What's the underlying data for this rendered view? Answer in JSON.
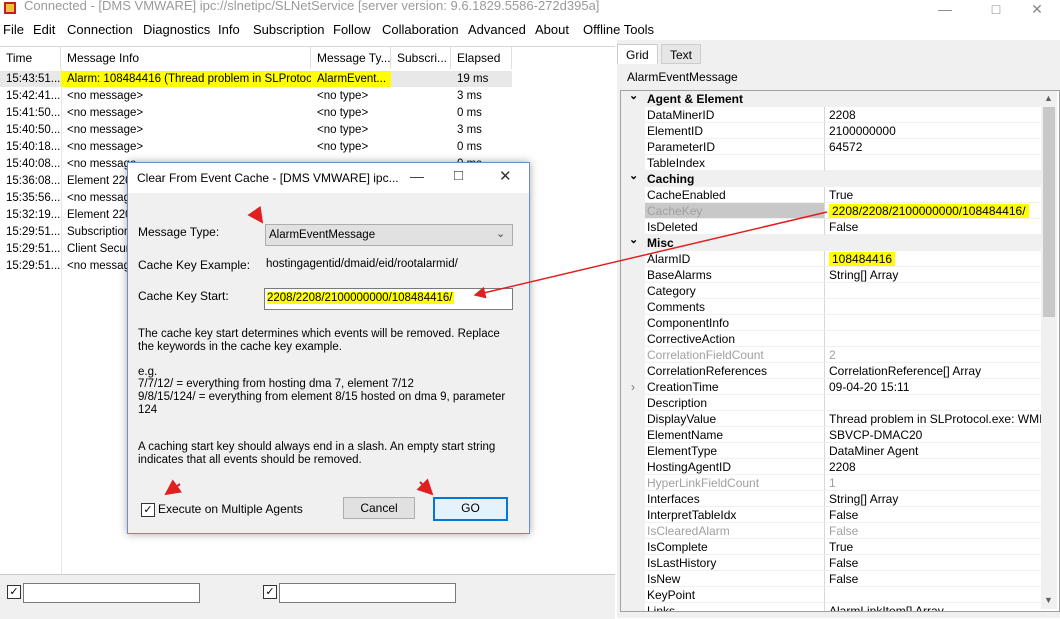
{
  "window": {
    "title": "Connected - [DMS VMWARE] ipc://slnetipc/SLNetService [server version: 9.6.1829.5586-272d395a]"
  },
  "menu": [
    "File",
    "Edit",
    "Connection",
    "Diagnostics",
    "Info",
    "Subscription",
    "Follow",
    "Collaboration",
    "Advanced",
    "About",
    "Offline Tools"
  ],
  "list": {
    "columns": [
      "Time",
      "Message Info",
      "Message Ty...",
      "Subscri...",
      "Elapsed"
    ],
    "rows": [
      {
        "time": "15:43:51...",
        "info": "Alarm: 108484416 (Thread problem in SLProtoc...",
        "type": "AlarmEvent...",
        "sub": "",
        "elapsed": "19 ms"
      },
      {
        "time": "15:42:41...",
        "info": "<no message>",
        "type": "<no type>",
        "sub": "",
        "elapsed": "3 ms"
      },
      {
        "time": "15:41:50...",
        "info": "<no message>",
        "type": "<no type>",
        "sub": "",
        "elapsed": "0 ms"
      },
      {
        "time": "15:40:50...",
        "info": "<no message>",
        "type": "<no type>",
        "sub": "",
        "elapsed": "3 ms"
      },
      {
        "time": "15:40:18...",
        "info": "<no message>",
        "type": "<no type>",
        "sub": "",
        "elapsed": "0 ms"
      },
      {
        "time": "15:40:08...",
        "info": "<no message",
        "type": "",
        "sub": "",
        "elapsed": "0 ms"
      },
      {
        "time": "15:36:08...",
        "info": "Element 2208",
        "type": "",
        "sub": "",
        "elapsed": ""
      },
      {
        "time": "15:35:56...",
        "info": "<no message",
        "type": "",
        "sub": "",
        "elapsed": ""
      },
      {
        "time": "15:32:19...",
        "info": "Element 2208",
        "type": "",
        "sub": "",
        "elapsed": ""
      },
      {
        "time": "15:29:51...",
        "info": "Subscription",
        "type": "",
        "sub": "",
        "elapsed": ""
      },
      {
        "time": "15:29:51...",
        "info": "Client Securit",
        "type": "",
        "sub": "",
        "elapsed": ""
      },
      {
        "time": "15:29:51...",
        "info": "<no message",
        "type": "",
        "sub": "",
        "elapsed": ""
      }
    ]
  },
  "right": {
    "tabs": [
      "Grid",
      "Text"
    ],
    "object_title": "AlarmEventMessage",
    "properties": [
      {
        "cat": "Agent & Element"
      },
      {
        "n": "DataMinerID",
        "v": "2208"
      },
      {
        "n": "ElementID",
        "v": "2100000000"
      },
      {
        "n": "ParameterID",
        "v": "64572"
      },
      {
        "n": "TableIndex",
        "v": ""
      },
      {
        "cat": "Caching"
      },
      {
        "n": "CacheEnabled",
        "v": "True"
      },
      {
        "n": "CacheKey",
        "v": "2208/2208/2100000000/108484416/",
        "gray": true,
        "hl": true
      },
      {
        "n": "IsDeleted",
        "v": "False"
      },
      {
        "cat": "Misc"
      },
      {
        "n": "AlarmID",
        "v": "108484416",
        "hl": true
      },
      {
        "n": "BaseAlarms",
        "v": "String[] Array"
      },
      {
        "n": "Category",
        "v": ""
      },
      {
        "n": "Comments",
        "v": ""
      },
      {
        "n": "ComponentInfo",
        "v": ""
      },
      {
        "n": "CorrectiveAction",
        "v": ""
      },
      {
        "n": "CorrelationFieldCount",
        "v": "2",
        "gray": true
      },
      {
        "n": "CorrelationReferences",
        "v": "CorrelationReference[] Array"
      },
      {
        "n": "CreationTime",
        "v": "09-04-20 15:11",
        "expand": true
      },
      {
        "n": "Description",
        "v": ""
      },
      {
        "n": "DisplayValue",
        "v": "Thread problem in SLProtocol.exe: WMIQuer"
      },
      {
        "n": "ElementName",
        "v": "SBVCP-DMAC20"
      },
      {
        "n": "ElementType",
        "v": "DataMiner Agent"
      },
      {
        "n": "HostingAgentID",
        "v": "2208"
      },
      {
        "n": "HyperLinkFieldCount",
        "v": "1",
        "gray": true
      },
      {
        "n": "Interfaces",
        "v": "String[] Array"
      },
      {
        "n": "InterpretTableIdx",
        "v": "False"
      },
      {
        "n": "IsClearedAlarm",
        "v": "False",
        "gray": true
      },
      {
        "n": "IsComplete",
        "v": "True"
      },
      {
        "n": "IsLastHistory",
        "v": "False"
      },
      {
        "n": "IsNew",
        "v": "False"
      },
      {
        "n": "KeyPoint",
        "v": ""
      },
      {
        "n": "Links",
        "v": "AlarmLinkItem[] Array"
      }
    ]
  },
  "dialog": {
    "title": "Clear From Event Cache - [DMS VMWARE] ipc...",
    "message_type_label": "Message Type:",
    "message_type_value": "AlarmEventMessage",
    "example_label": "Cache Key Example:",
    "example_value": "hostingagentid/dmaid/eid/rootalarmid/",
    "start_label": "Cache Key Start:",
    "start_value": "2208/2208/2100000000/108484416/",
    "help1": "The cache key start determines which events will be removed. Replace the keywords in the cache key example.",
    "eg": "e.g.",
    "eg1": "7/7/12/ = everything from hosting dma 7, element 7/12",
    "eg2": "9/8/15/124/ = everything from element 8/15 hosted on dma 9, parameter 124",
    "help2": "A caching start key should always end in a slash. An empty start string indicates that all events should be removed.",
    "multi_label": "Execute on Multiple Agents",
    "multi_checked": true,
    "cancel": "Cancel",
    "go": "GO"
  },
  "accent": {
    "highlight": "#ffff00",
    "arrow": "#e02020",
    "focus": "#0078d7"
  }
}
